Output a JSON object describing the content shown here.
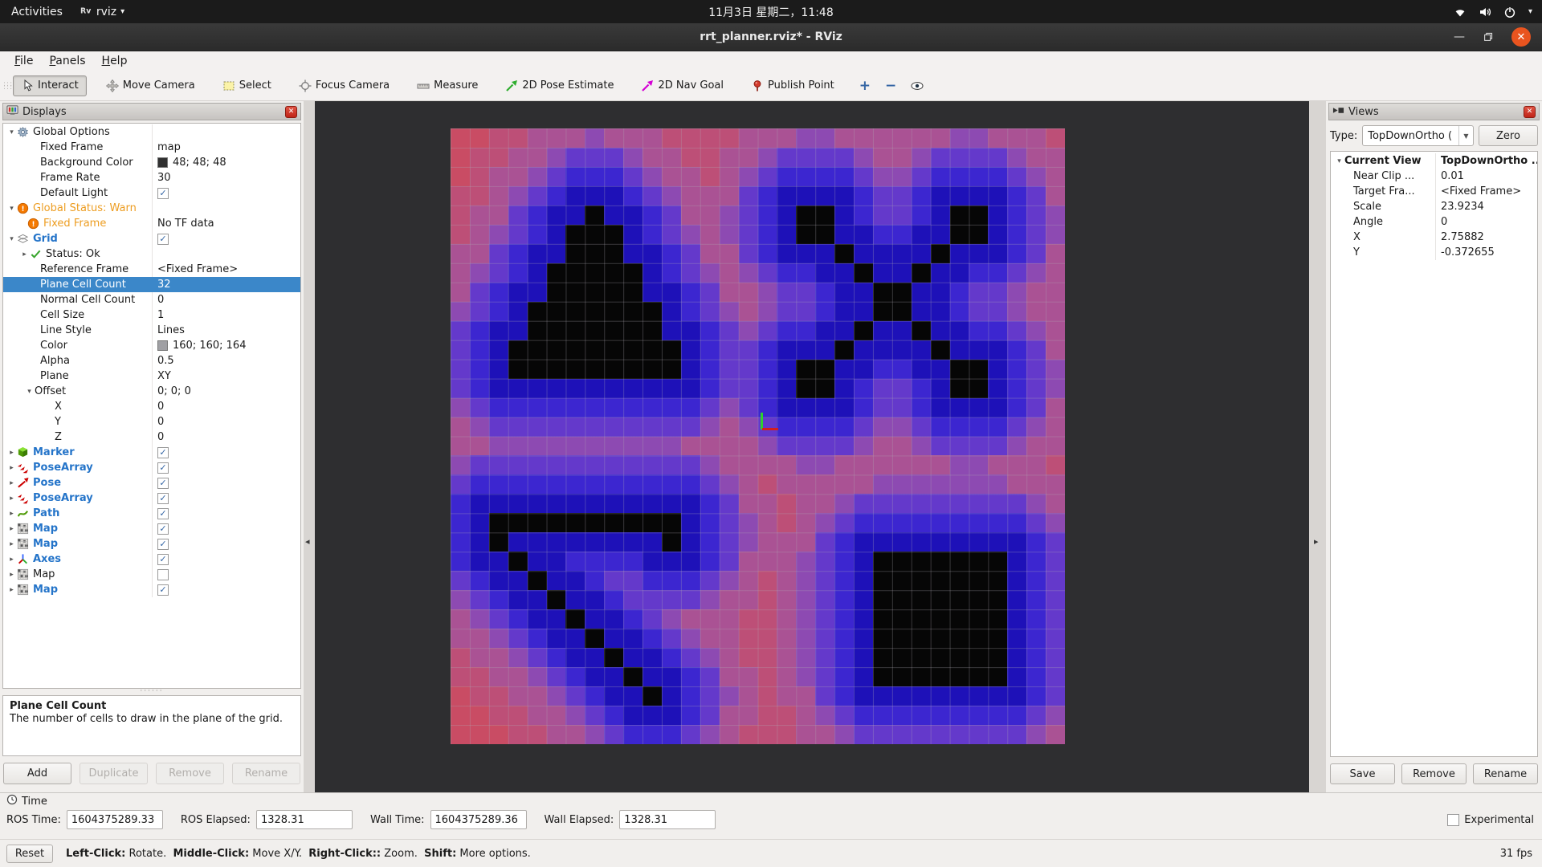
{
  "topbar": {
    "activities": "Activities",
    "app": "rviz",
    "clock": "11月3日 星期二，11:48"
  },
  "titlebar": {
    "title": "rrt_planner.rviz* - RViz"
  },
  "menubar": {
    "items": [
      "File",
      "Panels",
      "Help"
    ]
  },
  "toolbar": {
    "tools": [
      {
        "icon": "interact",
        "label": "Interact",
        "pressed": true
      },
      {
        "icon": "move-camera",
        "label": "Move Camera"
      },
      {
        "icon": "select",
        "label": "Select"
      },
      {
        "icon": "focus-camera",
        "label": "Focus Camera"
      },
      {
        "icon": "measure",
        "label": "Measure"
      },
      {
        "icon": "pose-estimate",
        "label": "2D Pose Estimate"
      },
      {
        "icon": "nav-goal",
        "label": "2D Nav Goal"
      },
      {
        "icon": "publish-point",
        "label": "Publish Point"
      },
      {
        "icon": "zoom-in",
        "label": ""
      },
      {
        "icon": "zoom-out",
        "label": ""
      },
      {
        "icon": "eye",
        "label": ""
      }
    ]
  },
  "displays": {
    "title": "Displays",
    "rows": [
      {
        "l": "Global Options",
        "pad": 4,
        "exp": "open",
        "icon": "gear"
      },
      {
        "l": "Fixed Frame",
        "v": "map",
        "vt": "text",
        "pad": 46
      },
      {
        "l": "Background Color",
        "v": "48; 48; 48",
        "vt": "swatch",
        "sc": "#303030",
        "pad": 46
      },
      {
        "l": "Frame Rate",
        "v": "30",
        "vt": "text",
        "pad": 46
      },
      {
        "l": "Default Light",
        "vt": "check",
        "pad": 46
      },
      {
        "l": "Global Status: Warn",
        "pad": 4,
        "exp": "open",
        "icon": "warn",
        "style": "orange"
      },
      {
        "l": "Fixed Frame",
        "v": "No TF data",
        "vt": "text",
        "pad": 30,
        "icon": "warn",
        "style": "orange"
      },
      {
        "l": "Grid",
        "vt": "check",
        "pad": 4,
        "exp": "open",
        "icon": "grid",
        "style": "blue"
      },
      {
        "l": "Status: Ok",
        "pad": 20,
        "exp": "closed",
        "icon": "check"
      },
      {
        "l": "Reference Frame",
        "v": "<Fixed Frame>",
        "vt": "text",
        "pad": 46
      },
      {
        "l": "Plane Cell Count",
        "v": "32",
        "vt": "text",
        "pad": 46,
        "sel": true
      },
      {
        "l": "Normal Cell Count",
        "v": "0",
        "vt": "text",
        "pad": 46
      },
      {
        "l": "Cell Size",
        "v": "1",
        "vt": "text",
        "pad": 46
      },
      {
        "l": "Line Style",
        "v": "Lines",
        "vt": "text",
        "pad": 46
      },
      {
        "l": "Color",
        "v": "160; 160; 164",
        "vt": "swatch",
        "sc": "#a0a0a4",
        "pad": 46
      },
      {
        "l": "Alpha",
        "v": "0.5",
        "vt": "text",
        "pad": 46
      },
      {
        "l": "Plane",
        "v": "XY",
        "vt": "text",
        "pad": 46
      },
      {
        "l": "Offset",
        "v": "0; 0; 0",
        "vt": "text",
        "pad": 26,
        "exp": "open"
      },
      {
        "l": "X",
        "v": "0",
        "vt": "text",
        "pad": 64
      },
      {
        "l": "Y",
        "v": "0",
        "vt": "text",
        "pad": 64
      },
      {
        "l": "Z",
        "v": "0",
        "vt": "text",
        "pad": 64
      },
      {
        "l": "Marker",
        "vt": "check",
        "pad": 4,
        "exp": "closed",
        "icon": "cube",
        "style": "blue"
      },
      {
        "l": "PoseArray",
        "vt": "check",
        "pad": 4,
        "exp": "closed",
        "icon": "posearray",
        "style": "blue"
      },
      {
        "l": "Pose",
        "vt": "check",
        "pad": 4,
        "exp": "closed",
        "icon": "pose",
        "style": "blue"
      },
      {
        "l": "PoseArray",
        "vt": "check",
        "pad": 4,
        "exp": "closed",
        "icon": "posearray",
        "style": "blue"
      },
      {
        "l": "Path",
        "vt": "check",
        "pad": 4,
        "exp": "closed",
        "icon": "path",
        "style": "blue"
      },
      {
        "l": "Map",
        "vt": "check",
        "pad": 4,
        "exp": "closed",
        "icon": "map",
        "style": "blue"
      },
      {
        "l": "Map",
        "vt": "check",
        "pad": 4,
        "exp": "closed",
        "icon": "map",
        "style": "blue"
      },
      {
        "l": "Axes",
        "vt": "check",
        "pad": 4,
        "exp": "closed",
        "icon": "axes",
        "style": "blue"
      },
      {
        "l": "Map",
        "vt": "uncheck",
        "pad": 4,
        "exp": "closed",
        "icon": "map"
      },
      {
        "l": "Map",
        "vt": "check",
        "pad": 4,
        "exp": "closed",
        "icon": "map",
        "style": "blue"
      }
    ],
    "description_title": "Plane Cell Count",
    "description_text": "The number of cells to draw in the plane of the grid.",
    "buttons": [
      {
        "label": "Add",
        "enabled": true
      },
      {
        "label": "Duplicate",
        "enabled": false
      },
      {
        "label": "Remove",
        "enabled": false
      },
      {
        "label": "Rename",
        "enabled": false
      }
    ]
  },
  "views": {
    "title": "Views",
    "type_label": "Type:",
    "type_value": "TopDownOrtho (",
    "zero_button": "Zero",
    "rows": [
      {
        "l": "Current View",
        "v": "TopDownOrtho ...",
        "bold": true,
        "exp": "open",
        "pad": 4
      },
      {
        "l": "Near Clip ...",
        "v": "0.01",
        "pad": 28
      },
      {
        "l": "Target Fra...",
        "v": "<Fixed Frame>",
        "pad": 28
      },
      {
        "l": "Scale",
        "v": "23.9234",
        "pad": 28
      },
      {
        "l": "Angle",
        "v": "0",
        "pad": 28
      },
      {
        "l": "X",
        "v": "2.75882",
        "pad": 28
      },
      {
        "l": "Y",
        "v": "-0.372655",
        "pad": 28
      }
    ],
    "buttons": [
      "Save",
      "Remove",
      "Rename"
    ]
  },
  "viewport": {
    "background": "#2e2e30",
    "map": {
      "obstacle_rows": [
        "................................",
        "................................",
        "................................",
        "................................",
        ".......#..........##......##....",
        "......###.........##......##....",
        "......###...........#....#......",
        ".....#####...........#..#.......",
        ".....#####............##........",
        "....#######...........##........",
        "....#######..........#..#.......",
        "...#########........#....#......",
        "...#########......##......##....",
        "..................##......##....",
        "................................",
        "................................",
        "................................",
        "................................",
        "................................",
        "................................",
        "..##########....................",
        "..#........#....................",
        "...#..................#######...",
        "....#.................#######...",
        ".....#................#######...",
        "......#...............#######...",
        ".......#..............#######...",
        "........#.............#######...",
        ".........#............#######...",
        "..........#.....................",
        "................................",
        "................................"
      ],
      "palette": [
        {
          "max": 1.45,
          "color": "#1e11b8"
        },
        {
          "max": 2.4,
          "color": "#3c26d0"
        },
        {
          "max": 3.2,
          "color": "#6439cb"
        },
        {
          "max": 4.1,
          "color": "#8d4ab2"
        },
        {
          "max": 5.2,
          "color": "#aa5294"
        },
        {
          "max": 6.6,
          "color": "#bd4f77"
        },
        {
          "max": 8.5,
          "color": "#c94c64"
        }
      ],
      "far_color": "#d34a59",
      "obstacle_color": "#060606"
    },
    "axes_marker": {
      "x_color": "#d21f1f",
      "y_color": "#2ed02e"
    }
  },
  "time_panel": {
    "title": "Time",
    "fields": [
      {
        "label": "ROS Time:",
        "value": "1604375289.33"
      },
      {
        "label": "ROS Elapsed:",
        "value": "1328.31"
      },
      {
        "label": "Wall Time:",
        "value": "1604375289.36"
      },
      {
        "label": "Wall Elapsed:",
        "value": "1328.31"
      }
    ],
    "experimental_label": "Experimental",
    "experimental_checked": false
  },
  "statusbar": {
    "reset_button": "Reset",
    "help_segments": [
      {
        "t": "Left-Click:",
        "b": true
      },
      {
        "t": " Rotate.  ",
        "b": false
      },
      {
        "t": "Middle-Click:",
        "b": true
      },
      {
        "t": " Move X/Y.  ",
        "b": false
      },
      {
        "t": "Right-Click::",
        "b": true
      },
      {
        "t": " Zoom.  ",
        "b": false
      },
      {
        "t": "Shift:",
        "b": true
      },
      {
        "t": " More options.",
        "b": false
      }
    ],
    "fps": "31 fps"
  }
}
